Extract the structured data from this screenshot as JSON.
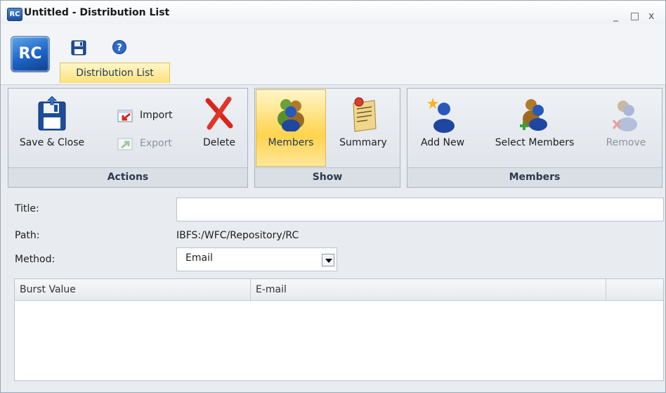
{
  "window": {
    "icon_text": "RC",
    "title": "Untitled - Distribution List",
    "minimize_glyph": "_",
    "maximize_glyph": "□",
    "close_glyph": "x"
  },
  "app_button": {
    "text": "RC"
  },
  "quick_access": {
    "save_icon": "floppy-disk-icon",
    "help_icon": "help-icon"
  },
  "ribbon_tab": {
    "label": "Distribution List"
  },
  "groups": {
    "actions": {
      "label": "Actions",
      "save_close": "Save & Close",
      "import": "Import",
      "export": "Export",
      "delete": "Delete"
    },
    "show": {
      "label": "Show",
      "members": "Members",
      "summary": "Summary"
    },
    "members": {
      "label": "Members",
      "add_new": "Add New",
      "select_members": "Select Members",
      "remove": "Remove"
    }
  },
  "form": {
    "title_label": "Title:",
    "title_value": "",
    "path_label": "Path:",
    "path_value": "IBFS:/WFC/Repository/RC",
    "method_label": "Method:",
    "method_value": "Email"
  },
  "grid": {
    "columns": [
      "Burst Value",
      "E-mail",
      ""
    ],
    "rows": []
  },
  "colors": {
    "accent_yellow": "#ffd34d",
    "brand_blue": "#1e63c4",
    "delete_red": "#d9261c"
  }
}
